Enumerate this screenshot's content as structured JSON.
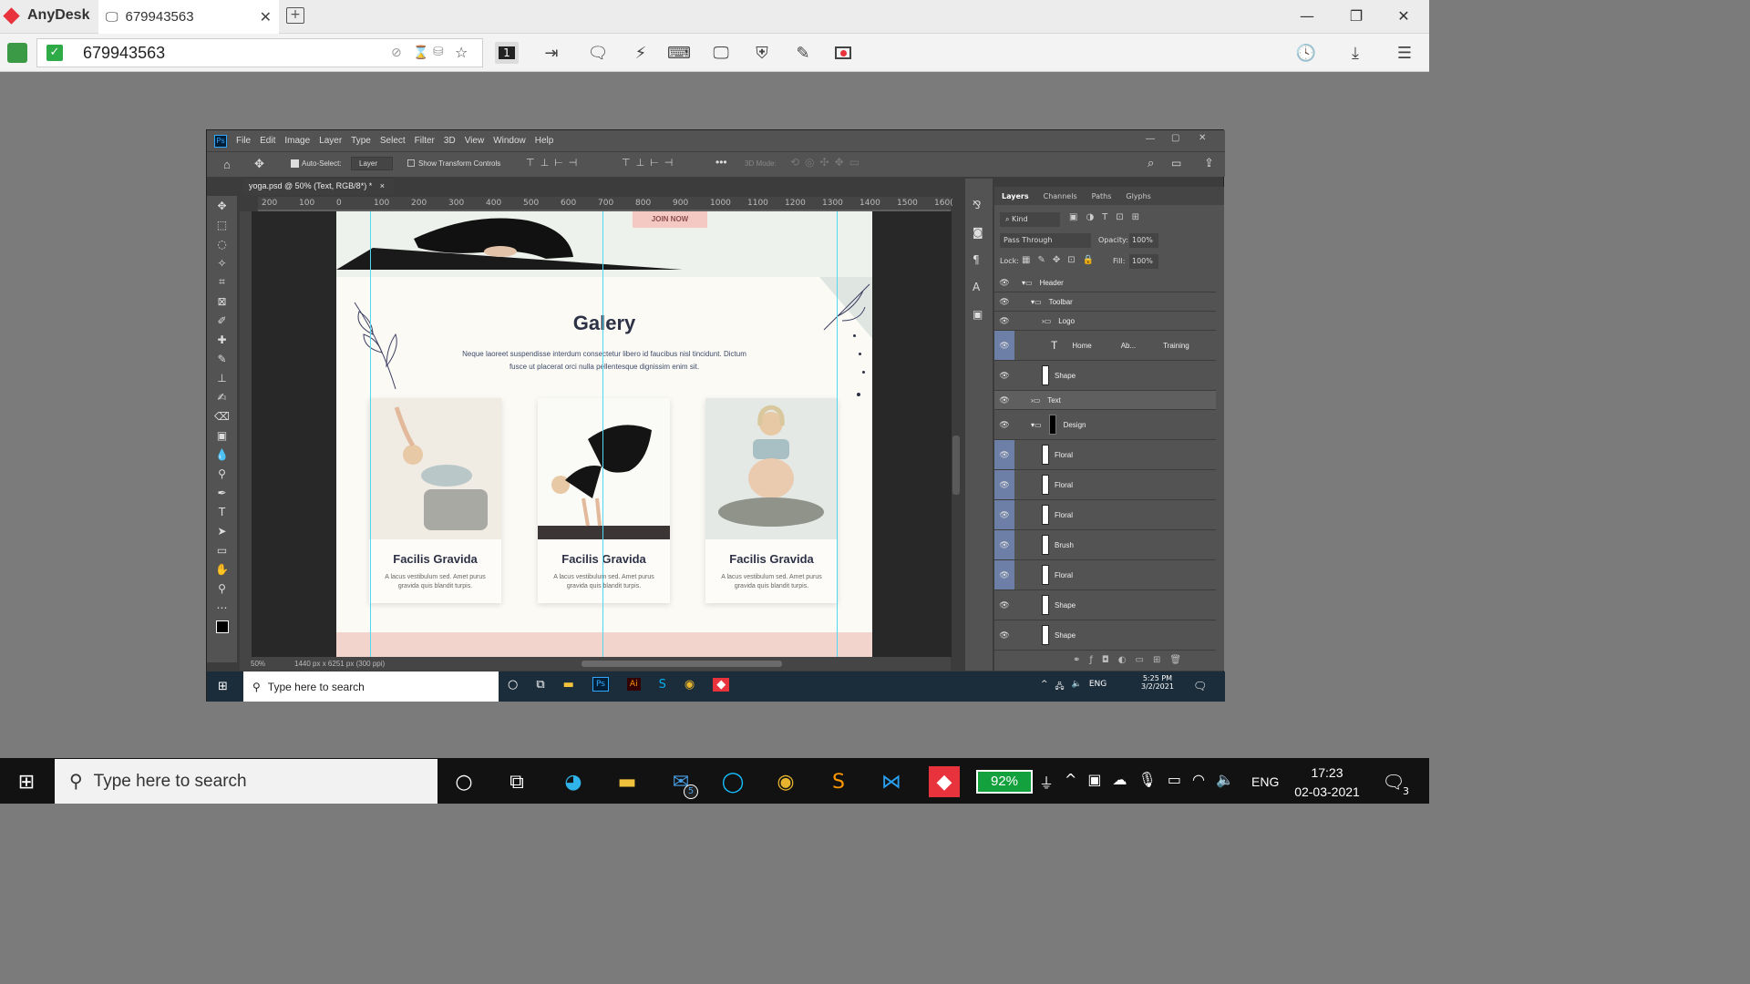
{
  "anydesk": {
    "app_name": "AnyDesk",
    "tab_title": "679943563",
    "address_value": "679943563",
    "display_number": "1"
  },
  "photoshop": {
    "menu": [
      "File",
      "Edit",
      "Image",
      "Layer",
      "Type",
      "Select",
      "Filter",
      "3D",
      "View",
      "Window",
      "Help"
    ],
    "options": {
      "auto_select": "Auto-Select:",
      "layer_dropdown": "Layer",
      "show_transform": "Show Transform Controls",
      "mode_3d": "3D Mode:"
    },
    "doc_tab": "yoga.psd @ 50% (Text, RGB/8*) *",
    "ruler_ticks": [
      "200",
      "100",
      "0",
      "100",
      "200",
      "300",
      "400",
      "500",
      "600",
      "700",
      "800",
      "900",
      "1000",
      "1100",
      "1200",
      "1300",
      "1400",
      "1500",
      "160("
    ],
    "status": {
      "zoom": "50%",
      "doc_size": "1440 px x 6251 px (300 ppi)"
    },
    "layers_panel": {
      "tabs": [
        "Layers",
        "Channels",
        "Paths",
        "Glyphs"
      ],
      "kind": "Kind",
      "blend_mode": "Pass Through",
      "opacity_label": "Opacity:",
      "opacity_value": "100%",
      "lock_label": "Lock:",
      "fill_label": "Fill:",
      "fill_value": "100%",
      "layers": [
        {
          "name": "Header"
        },
        {
          "name": "Toolbar"
        },
        {
          "name": "Logo"
        },
        {
          "name": "Home",
          "extra1": "Ab...",
          "extra2": "Training"
        },
        {
          "name": "Shape"
        },
        {
          "name": "Text"
        },
        {
          "name": "Design"
        },
        {
          "name": "Floral"
        },
        {
          "name": "Floral"
        },
        {
          "name": "Floral"
        },
        {
          "name": "Brush"
        },
        {
          "name": "Floral"
        },
        {
          "name": "Shape"
        },
        {
          "name": "Shape"
        }
      ]
    }
  },
  "artboard": {
    "join_button": "JOIN NOW",
    "title": "Galery",
    "subtitle_line1": "Neque laoreet suspendisse interdum consectetur libero id faucibus nisl tincidunt. Dictum",
    "subtitle_line2": "fusce ut placerat orci nulla pellentesque dignissim enim sit.",
    "cards": [
      {
        "title": "Facilis Gravida",
        "desc1": "A lacus vestibulum sed. Amet purus",
        "desc2": "gravida quis blandit turpis."
      },
      {
        "title": "Facilis Gravida",
        "desc1": "A lacus vestibulum sed. Amet purus",
        "desc2": "gravida quis blandit turpis."
      },
      {
        "title": "Facilis Gravida",
        "desc1": "A lacus vestibulum sed. Amet purus",
        "desc2": "gravida quis blandit turpis."
      }
    ]
  },
  "remote_taskbar": {
    "search_placeholder": "Type here to search",
    "lang": "ENG",
    "time": "5:25 PM",
    "date": "3/2/2021"
  },
  "host_taskbar": {
    "search_placeholder": "Type here to search",
    "mail_badge": "5",
    "battery": "92%",
    "lang": "ENG",
    "time": "17:23",
    "date": "02-03-2021",
    "notif_count": "3"
  },
  "colors": {
    "accent_pink": "#f4c9c4",
    "title_navy": "#2d3145",
    "guide_cyan": "#4fd8f2",
    "selected_layer": "#6d7fa6"
  }
}
